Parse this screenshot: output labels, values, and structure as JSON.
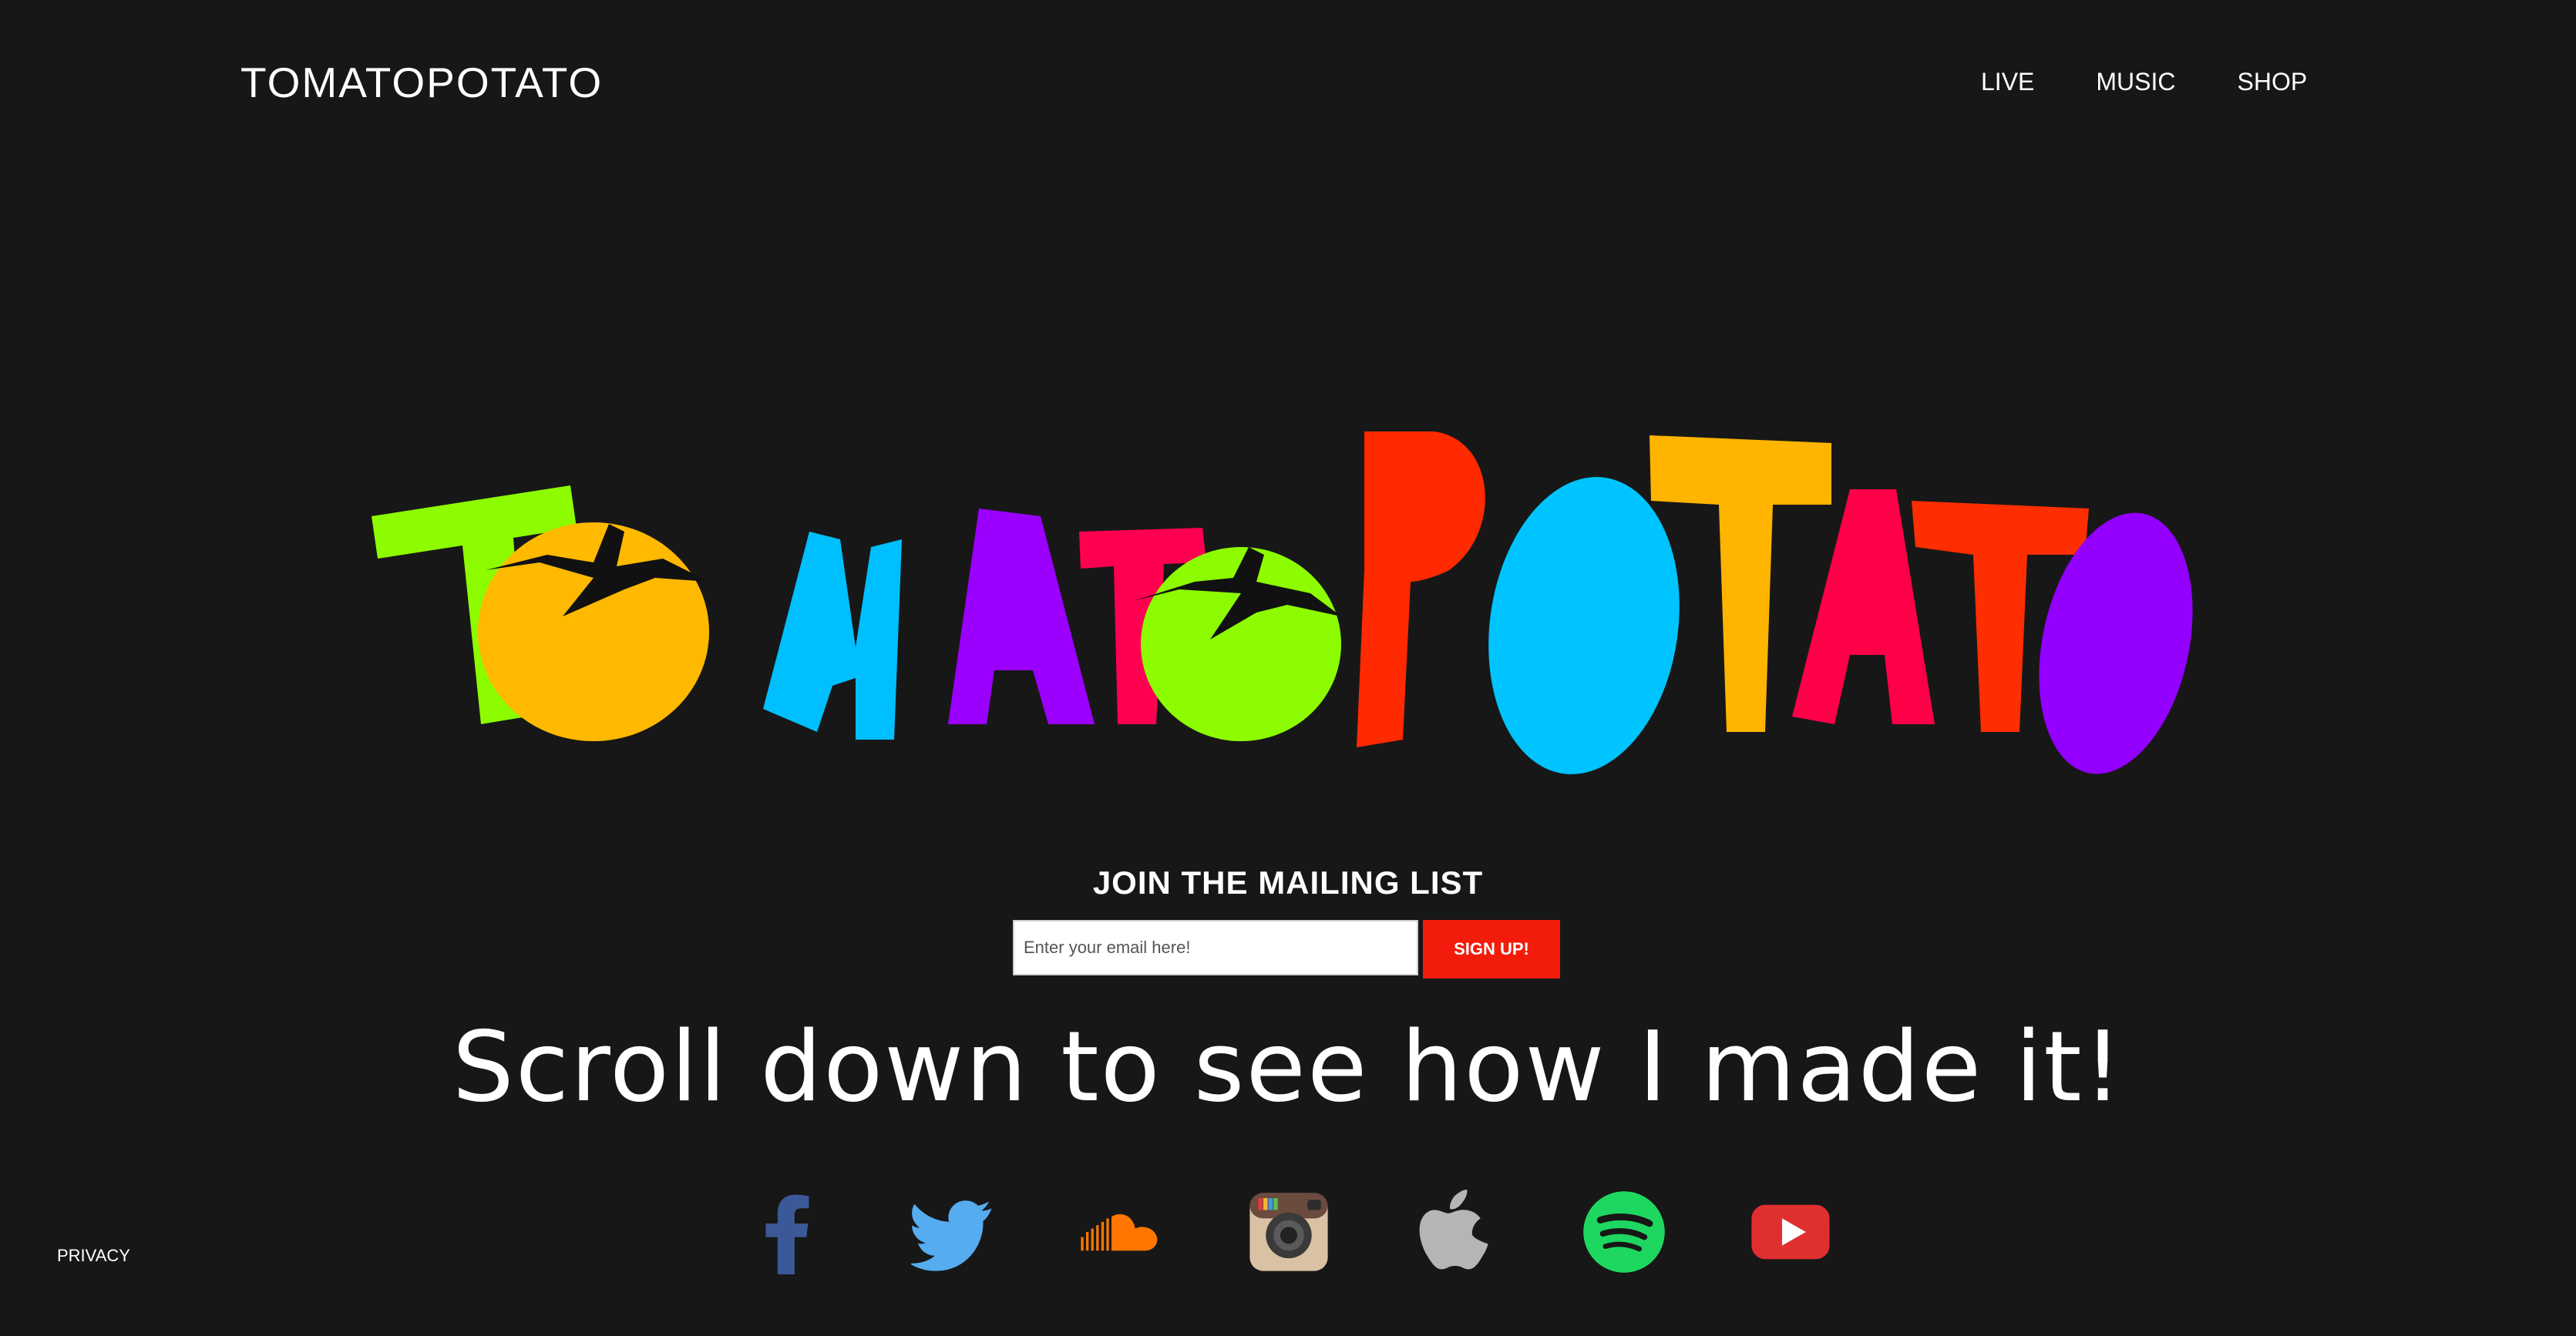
{
  "header": {
    "brand": "TOMATOPOTATO",
    "nav": [
      {
        "label": "LIVE"
      },
      {
        "label": "MUSIC"
      },
      {
        "label": "SHOP"
      }
    ]
  },
  "hero": {
    "logo_text": "TOMATOPOTATO",
    "letter_colors": [
      "#8dfc00",
      "#ffb900",
      "#00bfff",
      "#9b00ff",
      "#ff0051",
      "#8dfc00",
      "#ff2a00",
      "#00c4ff",
      "#ffb400",
      "#ff0048",
      "#ff2e00",
      "#9400ff"
    ]
  },
  "mailing": {
    "title": "JOIN THE MAILING LIST",
    "placeholder": "Enter your email here!",
    "button_label": "SIGN UP!"
  },
  "scroll_text": "Scroll down to see how I made it!",
  "social": [
    {
      "name": "facebook",
      "color": "#3b5998"
    },
    {
      "name": "twitter",
      "color": "#55acee"
    },
    {
      "name": "soundcloud",
      "color": "#ff7700"
    },
    {
      "name": "instagram",
      "color": "#d9c1a3"
    },
    {
      "name": "apple",
      "color": "#b5b5b5"
    },
    {
      "name": "spotify",
      "color": "#1ed760"
    },
    {
      "name": "youtube",
      "color": "#e02f2f"
    }
  ],
  "footer": {
    "privacy": "PRIVACY"
  }
}
